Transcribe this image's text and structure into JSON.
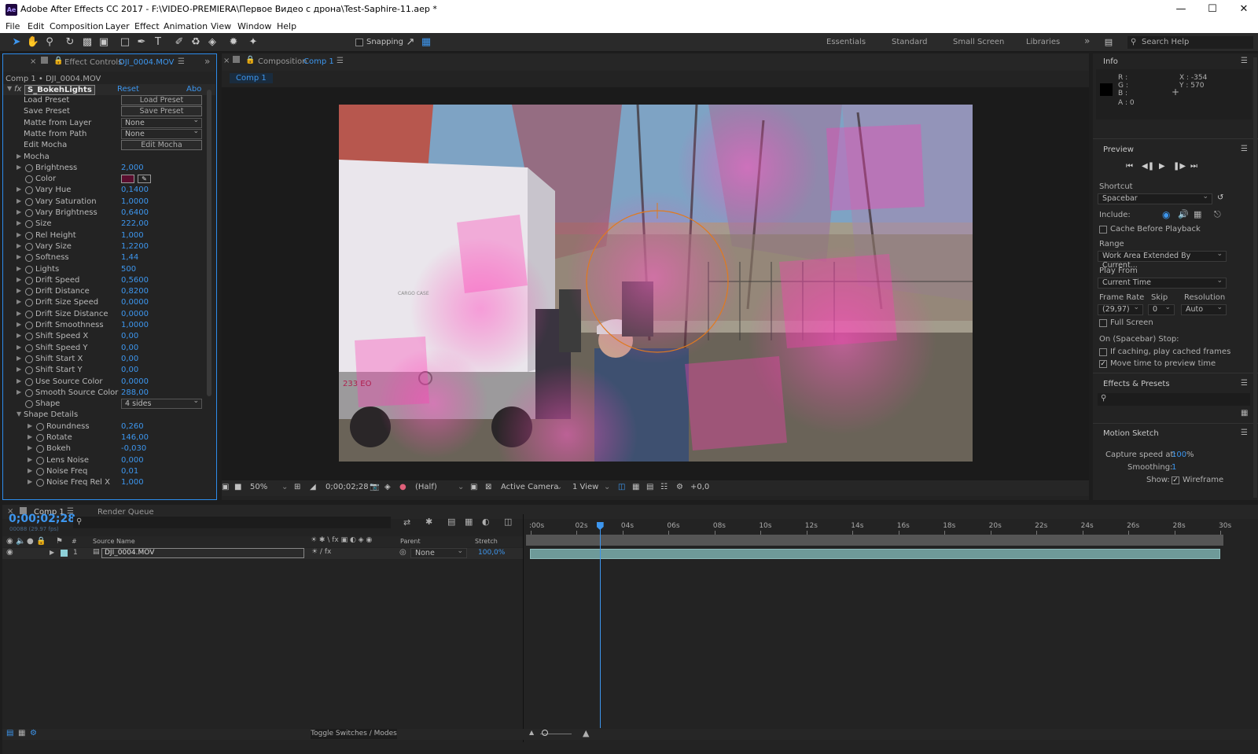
{
  "window": {
    "title": "Adobe After Effects CC 2017 - F:\\VIDEO-PREMIERA\\Первое Видео с дрона\\Test-Saphire-11.aep *",
    "logo": "Ae"
  },
  "menu": [
    "File",
    "Edit",
    "Composition",
    "Layer",
    "Effect",
    "Animation",
    "View",
    "Window",
    "Help"
  ],
  "toolbar": {
    "snapping": "Snapping",
    "workspaces": [
      "Essentials",
      "Standard",
      "Small Screen",
      "Libraries"
    ],
    "search_placeholder": "Search Help"
  },
  "effect_controls": {
    "tab_label": "Effect Controls",
    "tab_source": "DJI_0004.MOV",
    "breadcrumb": "Comp 1 • DJI_0004.MOV",
    "effect_name": "S_BokehLights",
    "reset": "Reset",
    "about": "Abo",
    "rows": [
      {
        "name": "Load Preset",
        "button": "Load Preset"
      },
      {
        "name": "Save Preset",
        "button": "Save Preset"
      },
      {
        "name": "Matte from Layer",
        "dropdown": "None"
      },
      {
        "name": "Matte from Path",
        "dropdown": "None"
      },
      {
        "name": "Edit Mocha",
        "button": "Edit Mocha"
      },
      {
        "name": "Mocha",
        "group": true
      },
      {
        "name": "Brightness",
        "value": "2,000"
      },
      {
        "name": "Color",
        "color": "#5a0e2e"
      },
      {
        "name": "Vary Hue",
        "value": "0,1400"
      },
      {
        "name": "Vary Saturation",
        "value": "1,0000"
      },
      {
        "name": "Vary Brightness",
        "value": "0,6400"
      },
      {
        "name": "Size",
        "value": "222,00"
      },
      {
        "name": "Rel Height",
        "value": "1,000"
      },
      {
        "name": "Vary Size",
        "value": "1,2200"
      },
      {
        "name": "Softness",
        "value": "1,44"
      },
      {
        "name": "Lights",
        "value": "500"
      },
      {
        "name": "Drift Speed",
        "value": "0,5600"
      },
      {
        "name": "Drift Distance",
        "value": "0,8200"
      },
      {
        "name": "Drift Size Speed",
        "value": "0,0000"
      },
      {
        "name": "Drift Size Distance",
        "value": "0,0000"
      },
      {
        "name": "Drift Smoothness",
        "value": "1,0000"
      },
      {
        "name": "Shift Speed X",
        "value": "0,00"
      },
      {
        "name": "Shift Speed Y",
        "value": "0,00"
      },
      {
        "name": "Shift Start X",
        "value": "0,00"
      },
      {
        "name": "Shift Start Y",
        "value": "0,00"
      },
      {
        "name": "Use Source Color",
        "value": "0,0000"
      },
      {
        "name": "Smooth Source Color",
        "value": "288,00"
      },
      {
        "name": "Shape",
        "dropdown": "4 sides"
      },
      {
        "name": "Shape Details",
        "group": true,
        "open": true
      },
      {
        "name": "Roundness",
        "value": "0,260",
        "sub": true
      },
      {
        "name": "Rotate",
        "value": "146,00",
        "sub": true
      },
      {
        "name": "Bokeh",
        "value": "-0,030",
        "sub": true
      },
      {
        "name": "Lens Noise",
        "value": "0,000",
        "sub": true
      },
      {
        "name": "Noise Freq",
        "value": "0,01",
        "sub": true
      },
      {
        "name": "Noise Freq Rel X",
        "value": "1,000",
        "sub": true
      }
    ]
  },
  "composition": {
    "tab_label": "Composition",
    "tab_name": "Comp 1",
    "comp_chip": "Comp 1",
    "van_text_plate": "233 EO",
    "van_side_text": "CARGO CASE",
    "viewer_bar": {
      "zoom": "50%",
      "timecode": "0;00;02;28",
      "resolution": "(Half)",
      "camera": "Active Camera",
      "views": "1 View",
      "exposure": "+0,0"
    }
  },
  "info": {
    "title": "Info",
    "r": "R :",
    "g": "G :",
    "b": "B :",
    "a": "A : 0",
    "x": "X : -354",
    "y": "Y : 570"
  },
  "preview": {
    "title": "Preview",
    "shortcut_label": "Shortcut",
    "shortcut": "Spacebar",
    "include_label": "Include:",
    "cache_before": "Cache Before Playback",
    "range_label": "Range",
    "range": "Work Area Extended By Current...",
    "play_from_label": "Play From",
    "play_from": "Current Time",
    "frame_rate_label": "Frame Rate",
    "skip_label": "Skip",
    "resolution_label": "Resolution",
    "frame_rate": "(29,97)",
    "skip": "0",
    "resolution": "Auto",
    "full_screen": "Full Screen",
    "on_stop": "On (Spacebar) Stop:",
    "if_caching": "If caching, play cached frames",
    "move_time": "Move time to preview time",
    "move_time_checked": true
  },
  "effects_presets": {
    "title": "Effects & Presets"
  },
  "motion_sketch": {
    "title": "Motion Sketch",
    "capture_label": "Capture speed at:",
    "capture_value": "100",
    "capture_unit": "%",
    "smoothing_label": "Smoothing:",
    "smoothing_value": "1",
    "show_label": "Show:",
    "wireframe": "Wireframe"
  },
  "timeline": {
    "tab": "Comp 1",
    "render_queue": "Render Queue",
    "timecode": "0;00;02;28",
    "frame_info": "00088 (29.97 fps)",
    "col_source": "Source Name",
    "col_parent": "Parent",
    "col_stretch": "Stretch",
    "hash": "#",
    "layer_num": "1",
    "layer_name": "DJI_0004.MOV",
    "layer_parent": "None",
    "layer_stretch": "100,0%",
    "ruler": [
      ":00s",
      "02s",
      "04s",
      "06s",
      "08s",
      "10s",
      "12s",
      "14s",
      "16s",
      "18s",
      "20s",
      "22s",
      "24s",
      "26s",
      "28s",
      "30s"
    ],
    "playhead_seconds": 3,
    "duration_seconds": 30,
    "toggle": "Toggle Switches / Modes"
  }
}
